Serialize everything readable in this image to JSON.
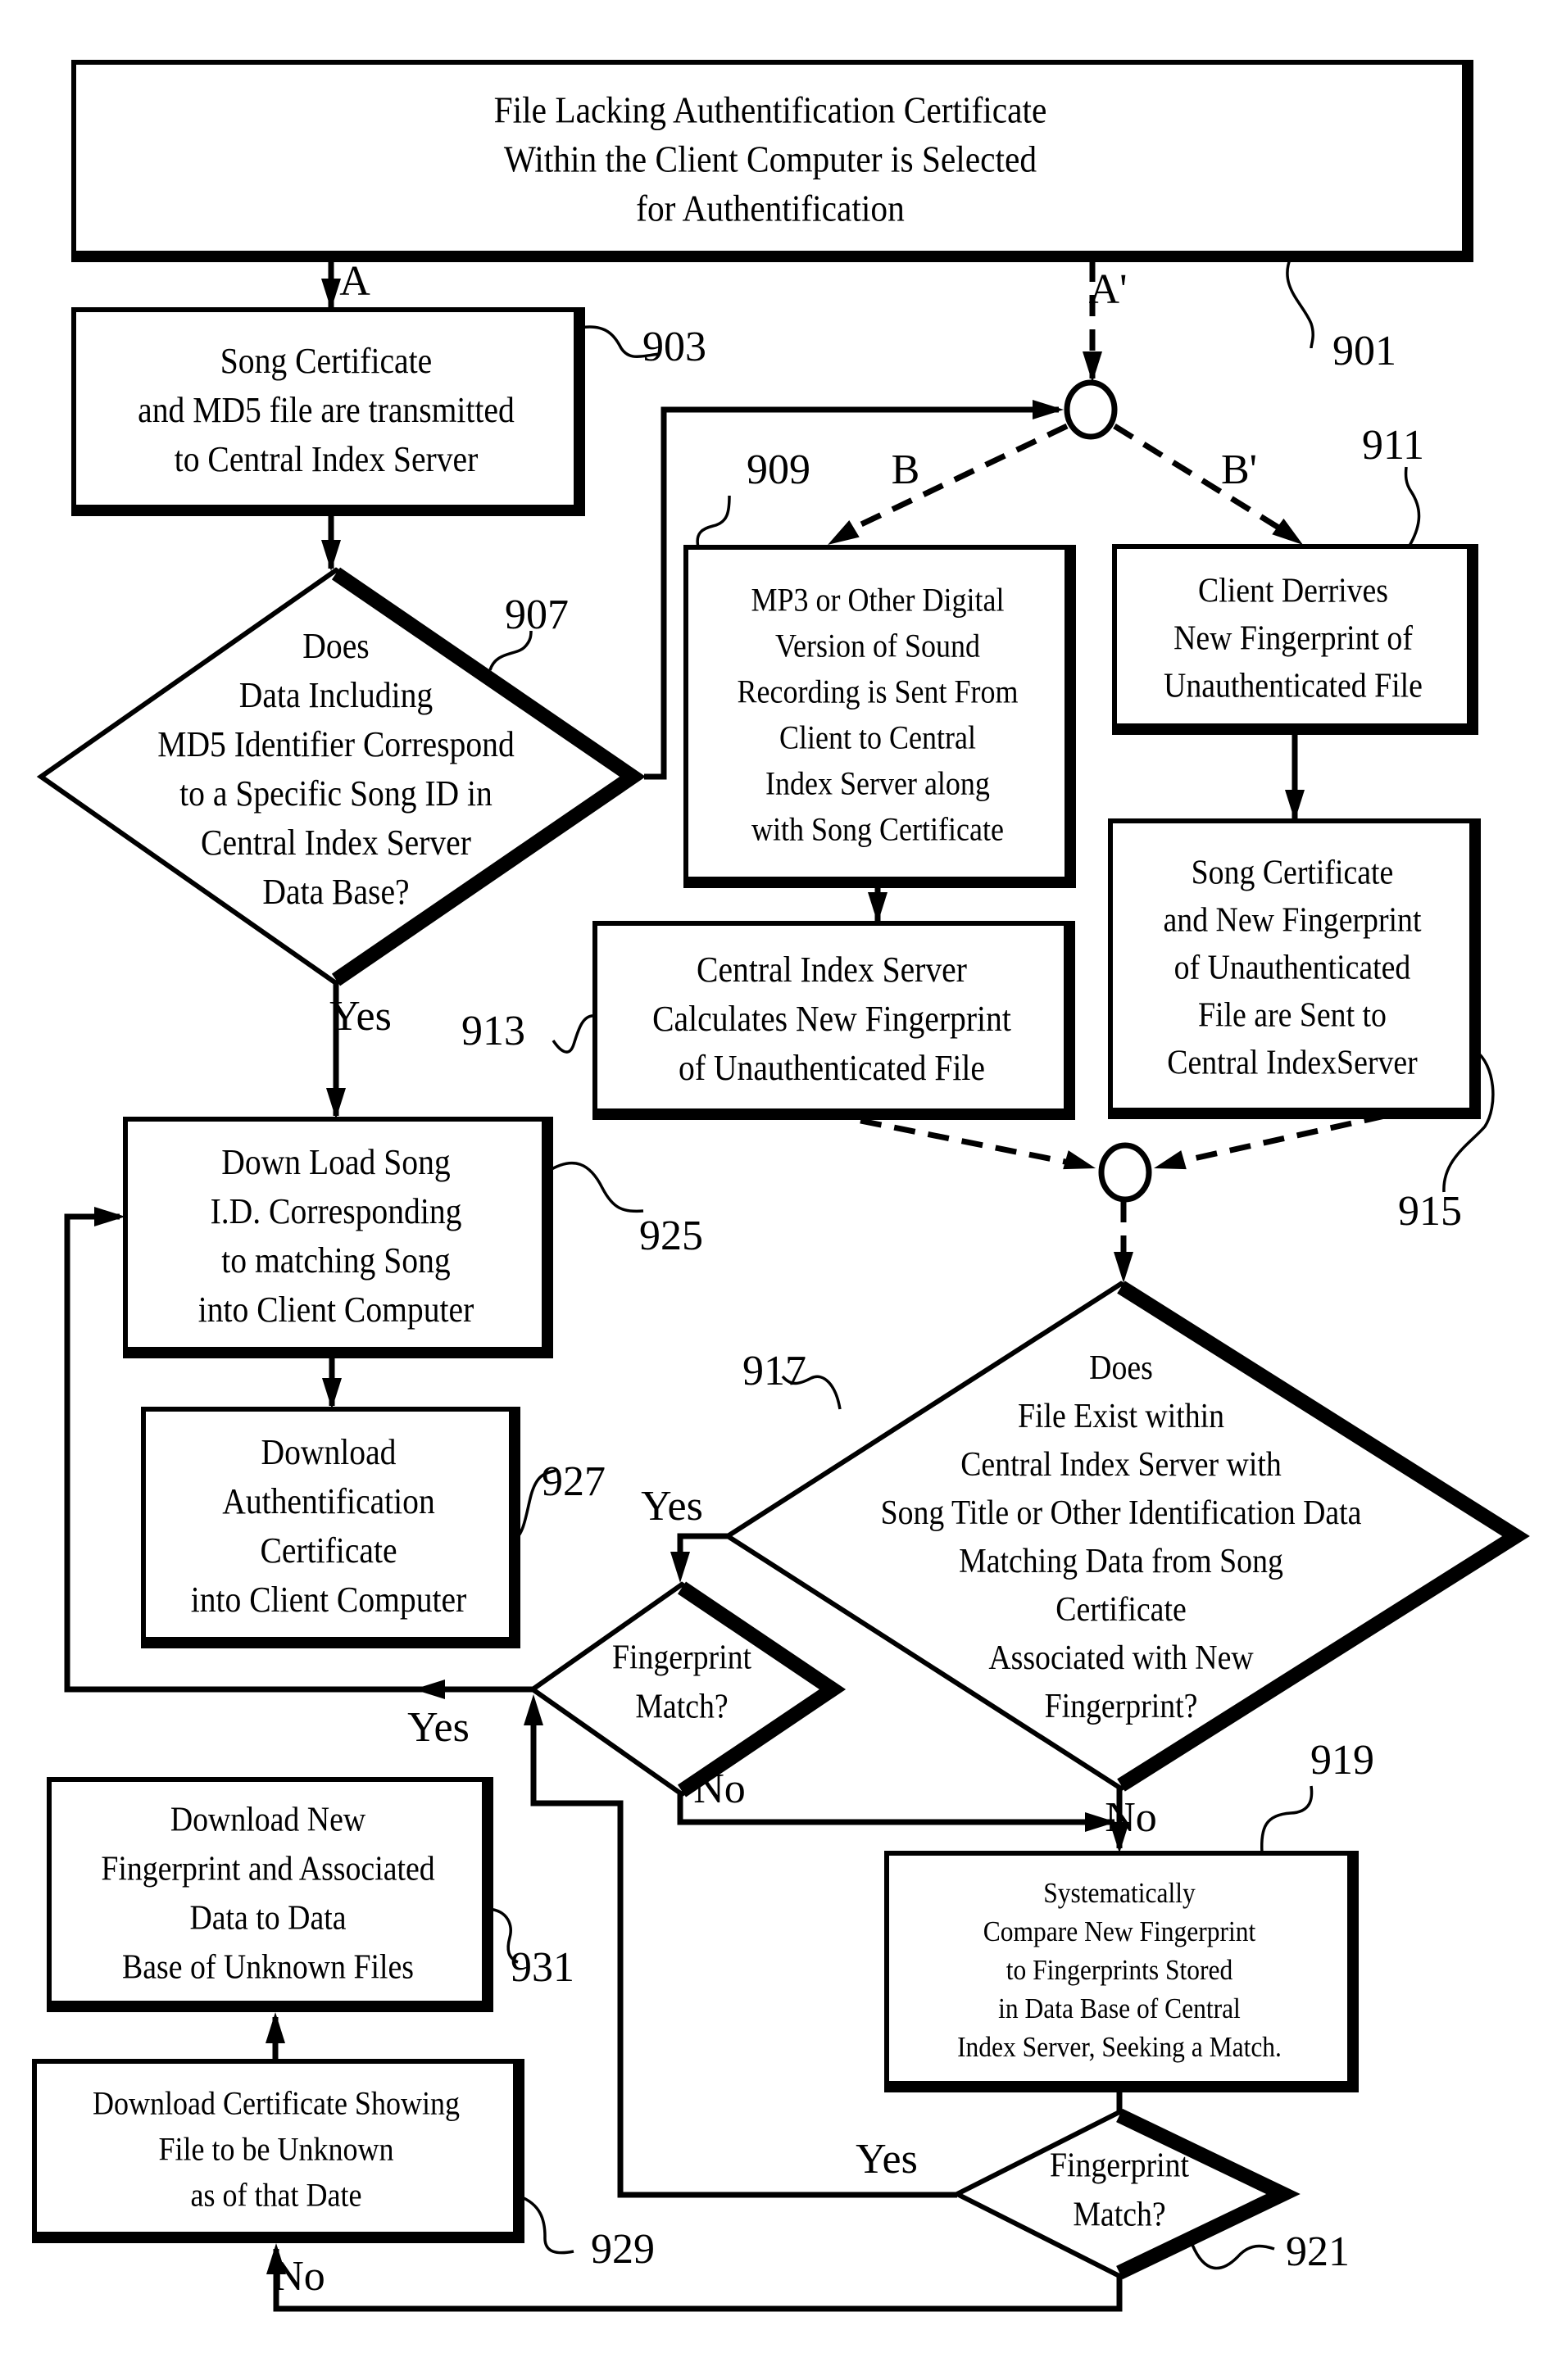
{
  "figure": {
    "type": "flowchart",
    "colors": {
      "ink": "#000000",
      "paper": "#ffffff"
    },
    "nodes": {
      "n901": {
        "ref": "901",
        "shape": "box",
        "lines": [
          "File Lacking Authentification Certificate",
          "Within the Client Computer is Selected",
          "for Authentification"
        ]
      },
      "n903": {
        "ref": "903",
        "shape": "box",
        "lines": [
          "Song Certificate",
          "and MD5 file are transmitted",
          "to Central Index Server"
        ]
      },
      "n907": {
        "ref": "907",
        "shape": "diamond",
        "lines": [
          "Does",
          "Data Including",
          "MD5 Identifier Correspond",
          "to a Specific Song ID in",
          "Central Index Server",
          "Data Base?"
        ]
      },
      "n909": {
        "ref": "909",
        "shape": "box",
        "lines": [
          "MP3 or Other Digital",
          "Version of Sound",
          "Recording is Sent From",
          "Client to Central",
          "Index Server along",
          "with Song Certificate"
        ]
      },
      "n911": {
        "ref": "911",
        "shape": "box",
        "lines": [
          "Client Derrives",
          "New Fingerprint of",
          "Unauthenticated File"
        ]
      },
      "n913": {
        "ref": "913",
        "shape": "box",
        "lines": [
          "Central Index Server",
          "Calculates New Fingerprint",
          "of Unauthenticated File"
        ]
      },
      "n915": {
        "ref": "915",
        "shape": "box",
        "lines": [
          "Song Certificate",
          "and New Fingerprint",
          "of Unauthenticated",
          "File are Sent to",
          "Central IndexServer"
        ]
      },
      "n917": {
        "ref": "917",
        "shape": "diamond",
        "lines": [
          "Does",
          "File Exist within",
          "Central Index Server with",
          "Song Title or Other Identification Data",
          "Matching Data from Song",
          "Certificate",
          "Associated with New",
          "Fingerprint?"
        ]
      },
      "nFP1": {
        "ref": "",
        "shape": "diamond",
        "lines": [
          "Fingerprint",
          "Match?"
        ]
      },
      "n919": {
        "ref": "919",
        "shape": "box",
        "lines": [
          "Systematically",
          "Compare New Fingerprint",
          "to Fingerprints Stored",
          "in Data Base of Central",
          "Index Server, Seeking a Match."
        ]
      },
      "n921": {
        "ref": "921",
        "shape": "diamond",
        "lines": [
          "Fingerprint",
          "Match?"
        ]
      },
      "n925": {
        "ref": "925",
        "shape": "box",
        "lines": [
          "Down Load Song",
          "I.D. Corresponding",
          "to matching Song",
          "into Client Computer"
        ]
      },
      "n927": {
        "ref": "927",
        "shape": "box",
        "lines": [
          "Download",
          "Authentification",
          "Certificate",
          "into Client Computer"
        ]
      },
      "n929": {
        "ref": "929",
        "shape": "box",
        "lines": [
          "Download Certificate Showing",
          "File to be Unknown",
          "as of that Date"
        ]
      },
      "n931": {
        "ref": "931",
        "shape": "box",
        "lines": [
          "Download New",
          "Fingerprint and Associated",
          "Data to Data",
          "Base of Unknown Files"
        ]
      },
      "jTop": {
        "ref": "",
        "shape": "junction",
        "lines": []
      },
      "jBottom": {
        "ref": "",
        "shape": "junction",
        "lines": []
      }
    },
    "edge_labels": {
      "a": "A",
      "a_prime": "A'",
      "b": "B",
      "b_prime": "B'",
      "yes_907": "Yes",
      "yes_917": "Yes",
      "no_917": "No",
      "yes_fp1": "Yes",
      "no_fp1": "No",
      "yes_921": "Yes",
      "no_921": "No"
    },
    "edges": [
      {
        "from": "n901",
        "to": "n903",
        "label": "A",
        "style": "solid"
      },
      {
        "from": "n901",
        "to": "jTop",
        "label": "A'",
        "style": "dashed"
      },
      {
        "from": "n903",
        "to": "n907",
        "label": "",
        "style": "solid"
      },
      {
        "from": "n907",
        "to": "jTop",
        "label": "",
        "style": "solid"
      },
      {
        "from": "n907",
        "to": "n925",
        "label": "Yes",
        "style": "solid"
      },
      {
        "from": "jTop",
        "to": "n909",
        "label": "B",
        "style": "dashed"
      },
      {
        "from": "jTop",
        "to": "n911",
        "label": "B'",
        "style": "dashed"
      },
      {
        "from": "n909",
        "to": "n913",
        "label": "",
        "style": "solid"
      },
      {
        "from": "n911",
        "to": "n915",
        "label": "",
        "style": "solid"
      },
      {
        "from": "n913",
        "to": "jBottom",
        "label": "",
        "style": "dashed"
      },
      {
        "from": "n915",
        "to": "jBottom",
        "label": "",
        "style": "dashed"
      },
      {
        "from": "jBottom",
        "to": "n917",
        "label": "",
        "style": "dashed"
      },
      {
        "from": "n917",
        "to": "nFP1",
        "label": "Yes",
        "style": "solid"
      },
      {
        "from": "n917",
        "to": "n919",
        "label": "No",
        "style": "solid"
      },
      {
        "from": "nFP1",
        "to": "n925",
        "label": "Yes",
        "style": "solid"
      },
      {
        "from": "nFP1",
        "to": "n919",
        "label": "No",
        "style": "solid"
      },
      {
        "from": "n925",
        "to": "n927",
        "label": "",
        "style": "solid"
      },
      {
        "from": "n919",
        "to": "n921",
        "label": "",
        "style": "solid"
      },
      {
        "from": "n921",
        "to": "nFP1",
        "label": "Yes",
        "style": "solid"
      },
      {
        "from": "n921",
        "to": "n929",
        "label": "No",
        "style": "solid"
      },
      {
        "from": "n929",
        "to": "n931",
        "label": "",
        "style": "solid"
      }
    ]
  }
}
